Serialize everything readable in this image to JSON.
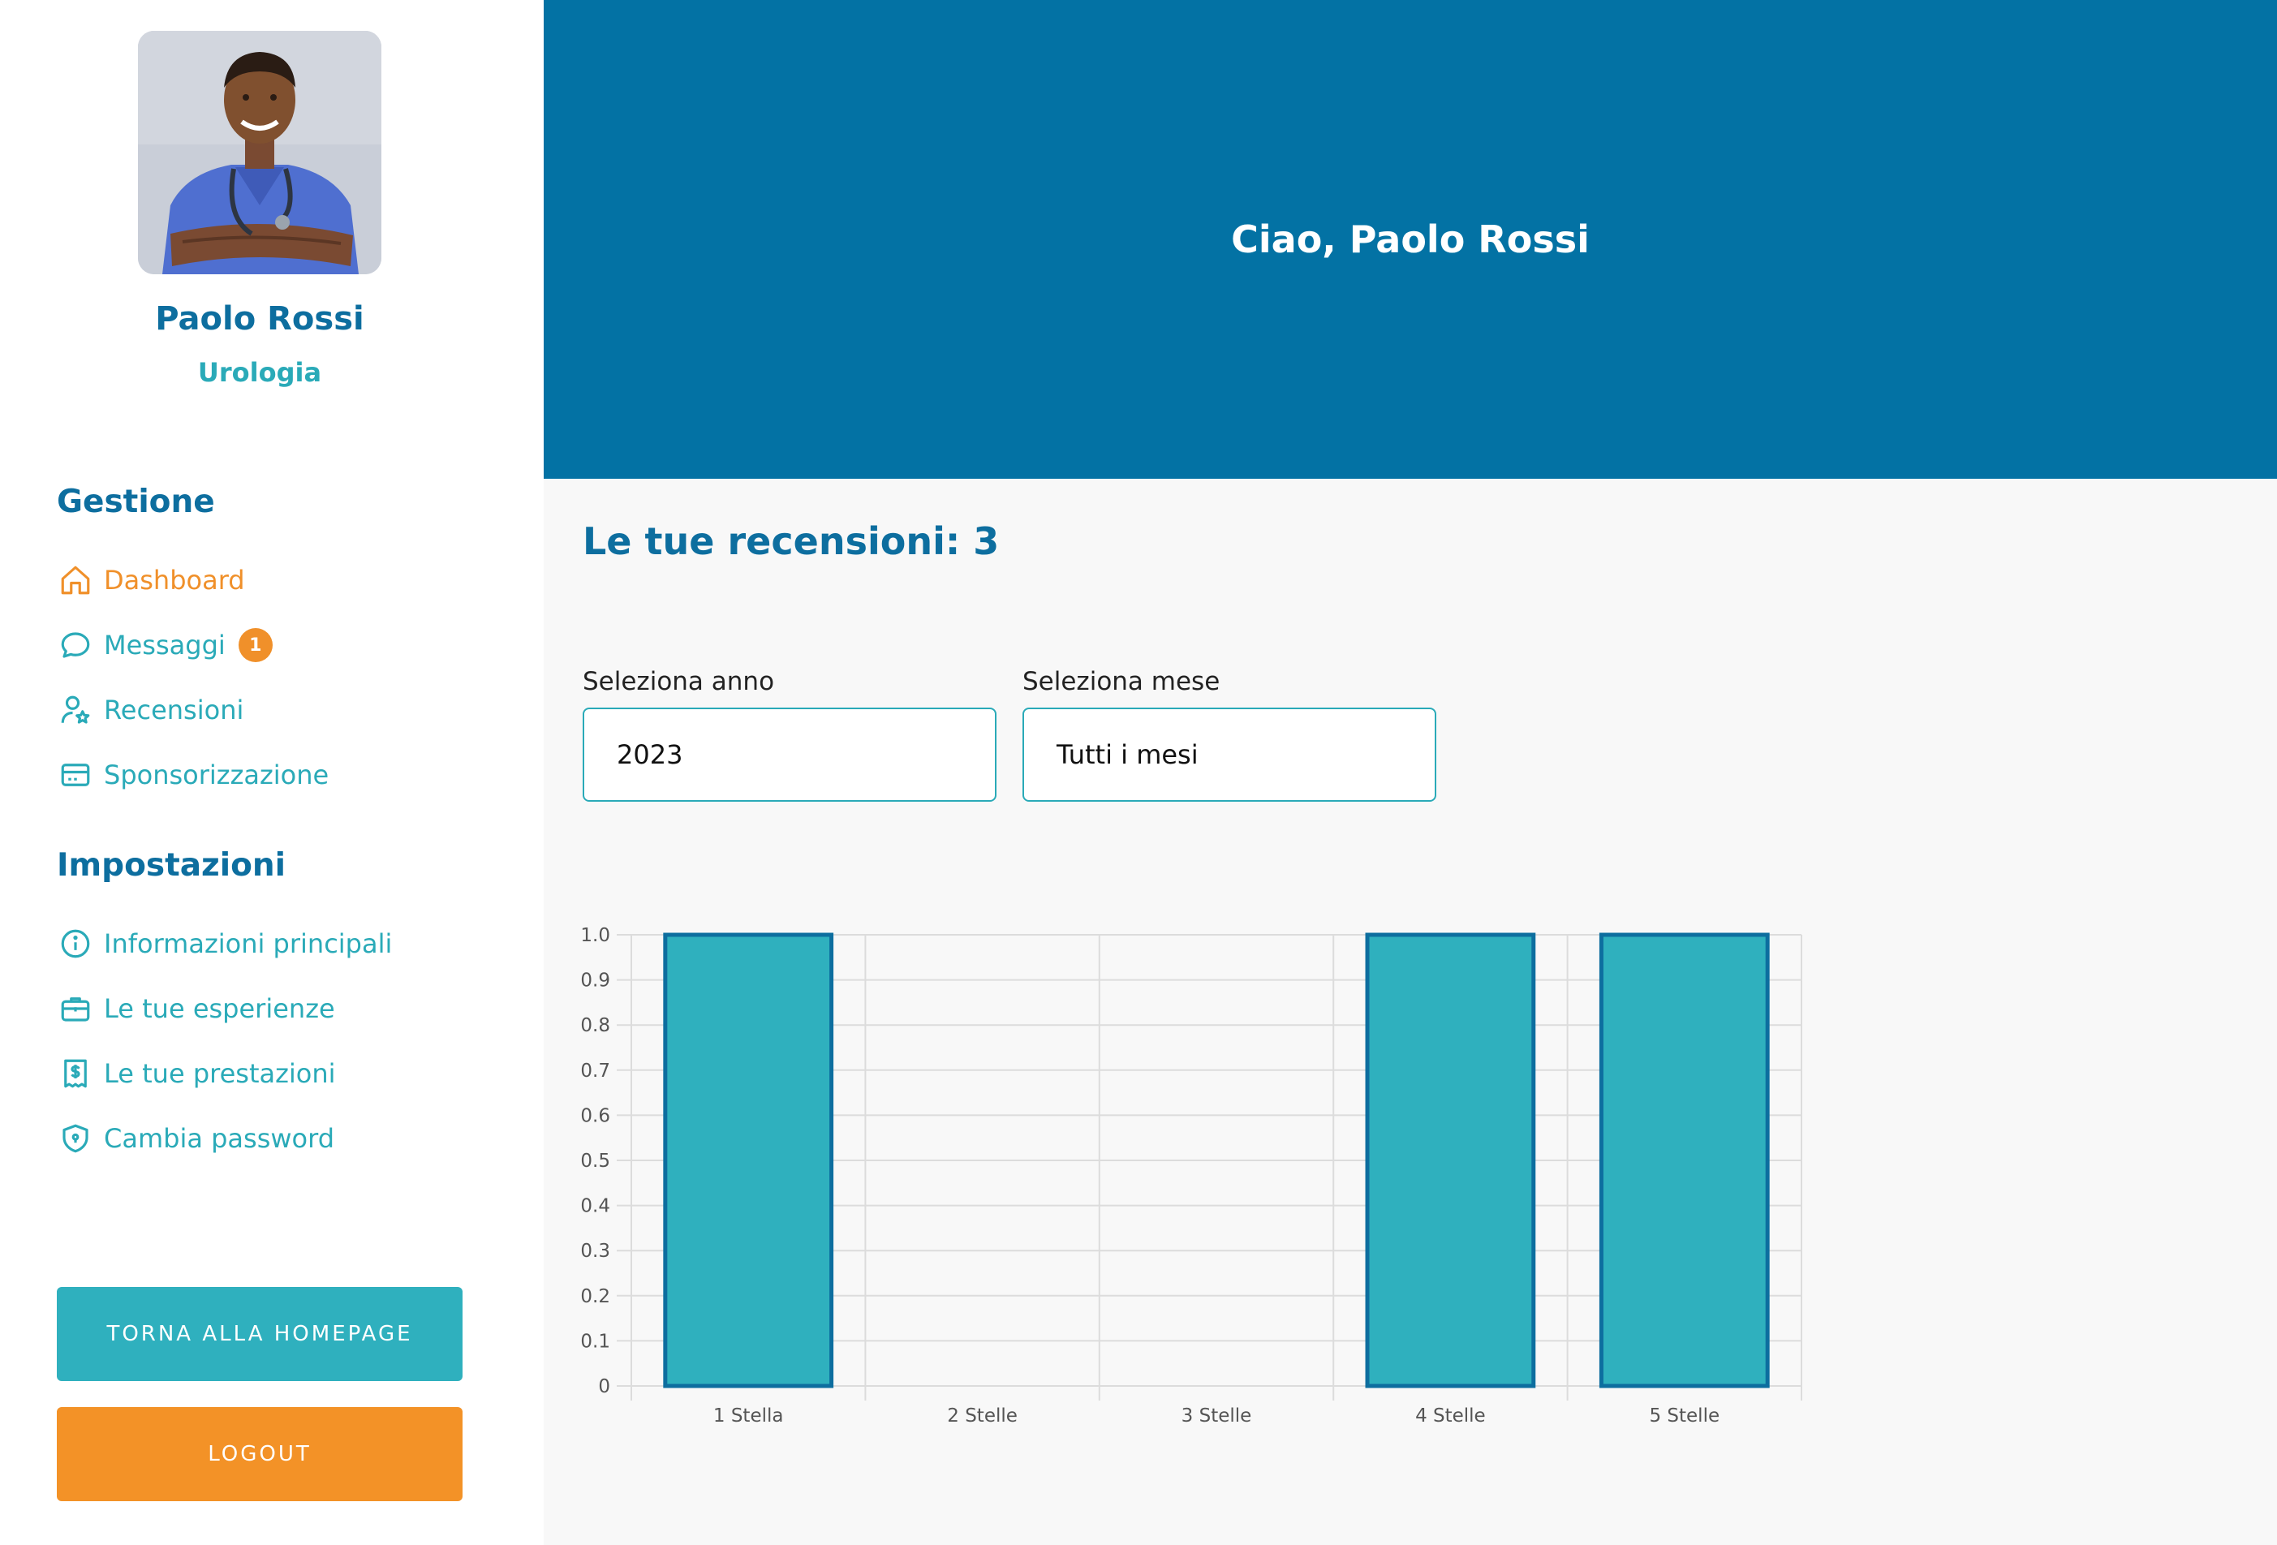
{
  "sidebar": {
    "doctor_name": "Paolo Rossi",
    "specialty": "Urologia",
    "sections": {
      "management": "Gestione",
      "settings": "Impostazioni"
    },
    "management_items": [
      {
        "label": "Dashboard",
        "icon": "home-icon",
        "active": true
      },
      {
        "label": "Messaggi",
        "icon": "chat-bubble-icon",
        "badge": "1"
      },
      {
        "label": "Recensioni",
        "icon": "user-star-icon"
      },
      {
        "label": "Sponsorizzazione",
        "icon": "credit-card-icon"
      }
    ],
    "settings_items": [
      {
        "label": "Informazioni principali",
        "icon": "info-icon"
      },
      {
        "label": "Le tue esperienze",
        "icon": "briefcase-icon"
      },
      {
        "label": "Le tue prestazioni",
        "icon": "receipt-dollar-icon"
      },
      {
        "label": "Cambia password",
        "icon": "shield-icon"
      }
    ],
    "home_button": "TORNA ALLA HOMEPAGE",
    "logout_button": "LOGOUT"
  },
  "header": {
    "greeting": "Ciao, Paolo Rossi"
  },
  "main": {
    "reviews_title": "Le tue recensioni: 3",
    "year_label": "Seleziona anno",
    "year_value": "2023",
    "month_label": "Seleziona mese",
    "month_value": "Tutti i mesi"
  },
  "colors": {
    "primary": "#0372a4",
    "accent": "#2fb0be",
    "orange": "#f39227",
    "bar_fill": "#2fb0be",
    "bar_border": "#0d6e9f"
  },
  "chart_data": {
    "type": "bar",
    "categories": [
      "1 Stella",
      "2 Stelle",
      "3 Stelle",
      "4 Stelle",
      "5 Stelle"
    ],
    "values": [
      1,
      0,
      0,
      1,
      1
    ],
    "ylim": [
      0,
      1.0
    ],
    "yticks": [
      "0",
      "0.1",
      "0.2",
      "0.3",
      "0.4",
      "0.5",
      "0.6",
      "0.7",
      "0.8",
      "0.9",
      "1.0"
    ],
    "grid": true,
    "legend": false,
    "title": "",
    "xlabel": "",
    "ylabel": ""
  }
}
